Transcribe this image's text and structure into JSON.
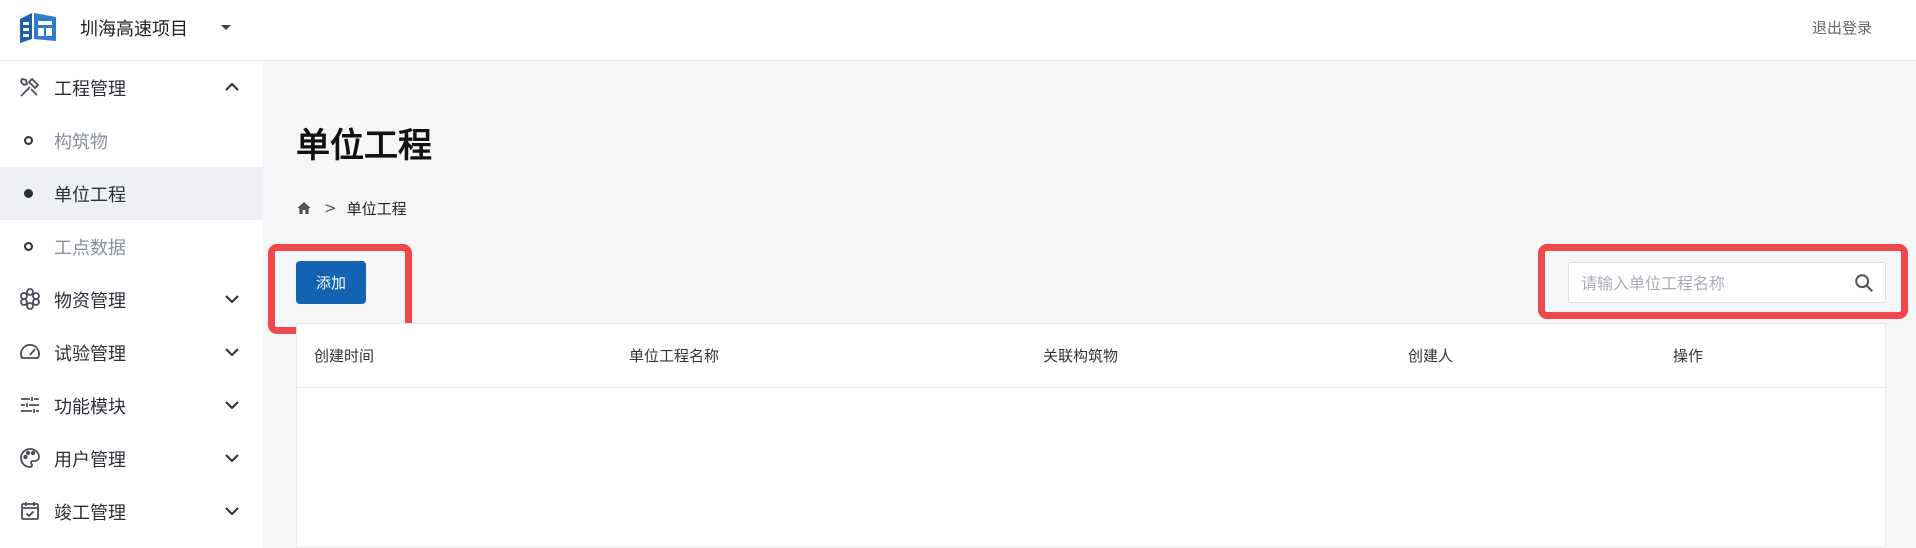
{
  "header": {
    "project_name": "圳海高速项目",
    "logout_label": "退出登录"
  },
  "sidebar": {
    "groups": [
      {
        "label": "工程管理",
        "icon": "tools-icon",
        "expanded": true
      },
      {
        "label": "物资管理",
        "icon": "molecule-icon",
        "expanded": false
      },
      {
        "label": "试验管理",
        "icon": "gauge-icon",
        "expanded": false
      },
      {
        "label": "功能模块",
        "icon": "sliders-icon",
        "expanded": false
      },
      {
        "label": "用户管理",
        "icon": "palette-icon",
        "expanded": false
      },
      {
        "label": "竣工管理",
        "icon": "calendar-check-icon",
        "expanded": false
      }
    ],
    "sub_items": [
      {
        "label": "构筑物",
        "active": false
      },
      {
        "label": "单位工程",
        "active": true
      },
      {
        "label": "工点数据",
        "active": false
      }
    ]
  },
  "main": {
    "title": "单位工程",
    "breadcrumb": {
      "separator": ">",
      "current": "单位工程"
    },
    "add_button_label": "添加",
    "search": {
      "placeholder": "请输入单位工程名称",
      "value": ""
    },
    "table": {
      "columns": [
        "创建时间",
        "单位工程名称",
        "关联构筑物",
        "创建人",
        "操作"
      ],
      "rows": []
    }
  },
  "colors": {
    "primary": "#1463b3",
    "highlight": "#f0484a",
    "sidebar_active_bg": "#eef0f3",
    "page_bg": "#f5f6f8"
  }
}
